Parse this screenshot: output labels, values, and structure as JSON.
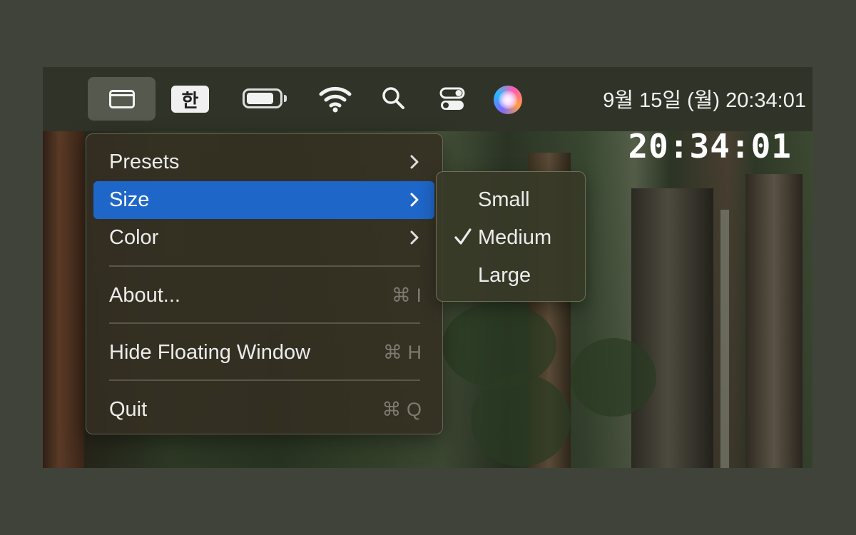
{
  "menubar": {
    "ime_label": "한",
    "battery_level": 0.85,
    "datetime": "9월 15일 (월) 20:34:01"
  },
  "floating_clock": "20:34:01",
  "menu": {
    "items": [
      {
        "label": "Presets"
      },
      {
        "label": "Size"
      },
      {
        "label": "Color"
      },
      {
        "label": "About...",
        "shortcut": "⌘ I"
      },
      {
        "label": "Hide Floating Window",
        "shortcut": "⌘ H"
      },
      {
        "label": "Quit",
        "shortcut": "⌘ Q"
      }
    ],
    "highlighted": "Size"
  },
  "size_submenu": {
    "items": [
      {
        "label": "Small",
        "checked": false
      },
      {
        "label": "Medium",
        "checked": true
      },
      {
        "label": "Large",
        "checked": false
      }
    ]
  },
  "colors": {
    "highlight": "#1f66c9",
    "menubar": "#2f3328",
    "outer_background": "#3f4339"
  }
}
